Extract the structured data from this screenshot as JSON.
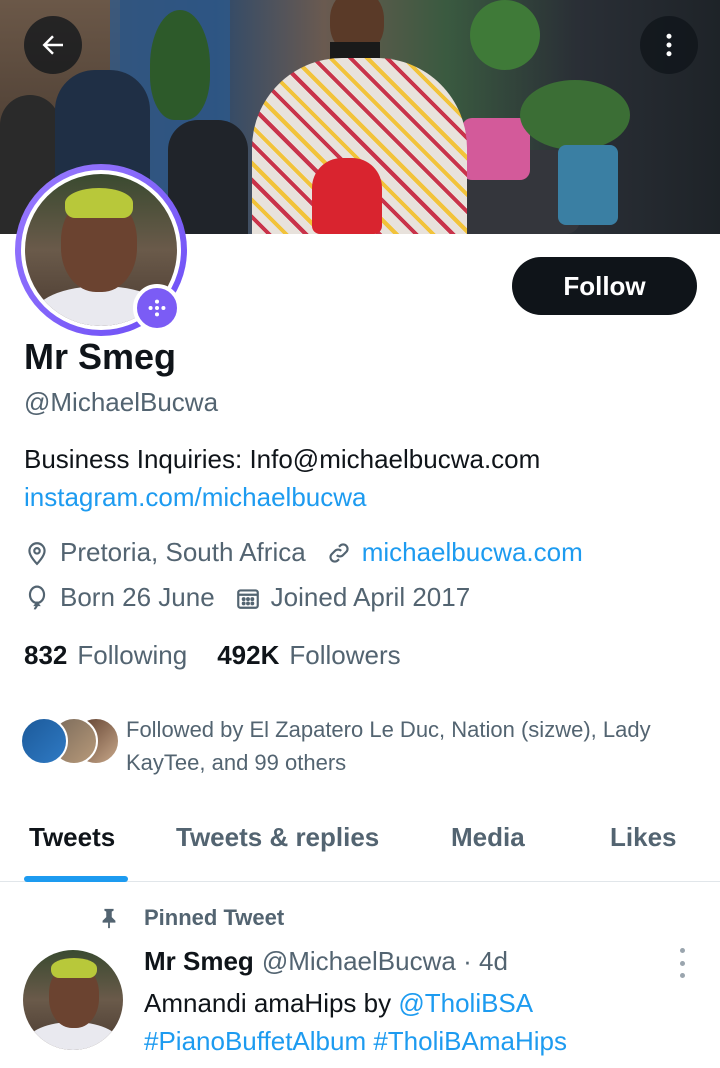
{
  "profile": {
    "name": "Mr Smeg",
    "handle": "@MichaelBucwa",
    "follow_label": "Follow",
    "bio": "Business Inquiries: Info@michaelbucwa.com",
    "bio_link": "instagram.com/michaelbucwa",
    "location": "Pretoria, South Africa",
    "website": "michaelbucwa.com",
    "birthday": "Born 26 June",
    "joined": "Joined April 2017",
    "following_count": "832",
    "following_label": "Following",
    "followers_count": "492K",
    "followers_label": "Followers",
    "followed_by": "Followed by El Zapatero Le Duc, Nation (sizwe), Lady KayTee, and 99 others"
  },
  "tabs": [
    "Tweets",
    "Tweets & replies",
    "Media",
    "Likes"
  ],
  "pinned_label": "Pinned Tweet",
  "tweet": {
    "name": "Mr Smeg",
    "handle": "@MichaelBucwa",
    "separator": "·",
    "time": "4d",
    "text_prefix": "Amnandi amaHips by ",
    "mention": "@TholiBSA",
    "hashtags": "#PianoBuffetAlbum #TholiBAmaHips"
  },
  "icons": {
    "back": "arrow-left-icon",
    "more": "more-vertical-icon",
    "location": "location-pin-icon",
    "link": "link-icon",
    "birthday": "balloon-icon",
    "calendar": "calendar-icon",
    "pin": "pin-icon",
    "badge": "spaces-badge-icon"
  },
  "colors": {
    "accent": "#1d9bf0",
    "badge": "#7b5cf5",
    "text": "#0f1419",
    "muted": "#536471"
  }
}
